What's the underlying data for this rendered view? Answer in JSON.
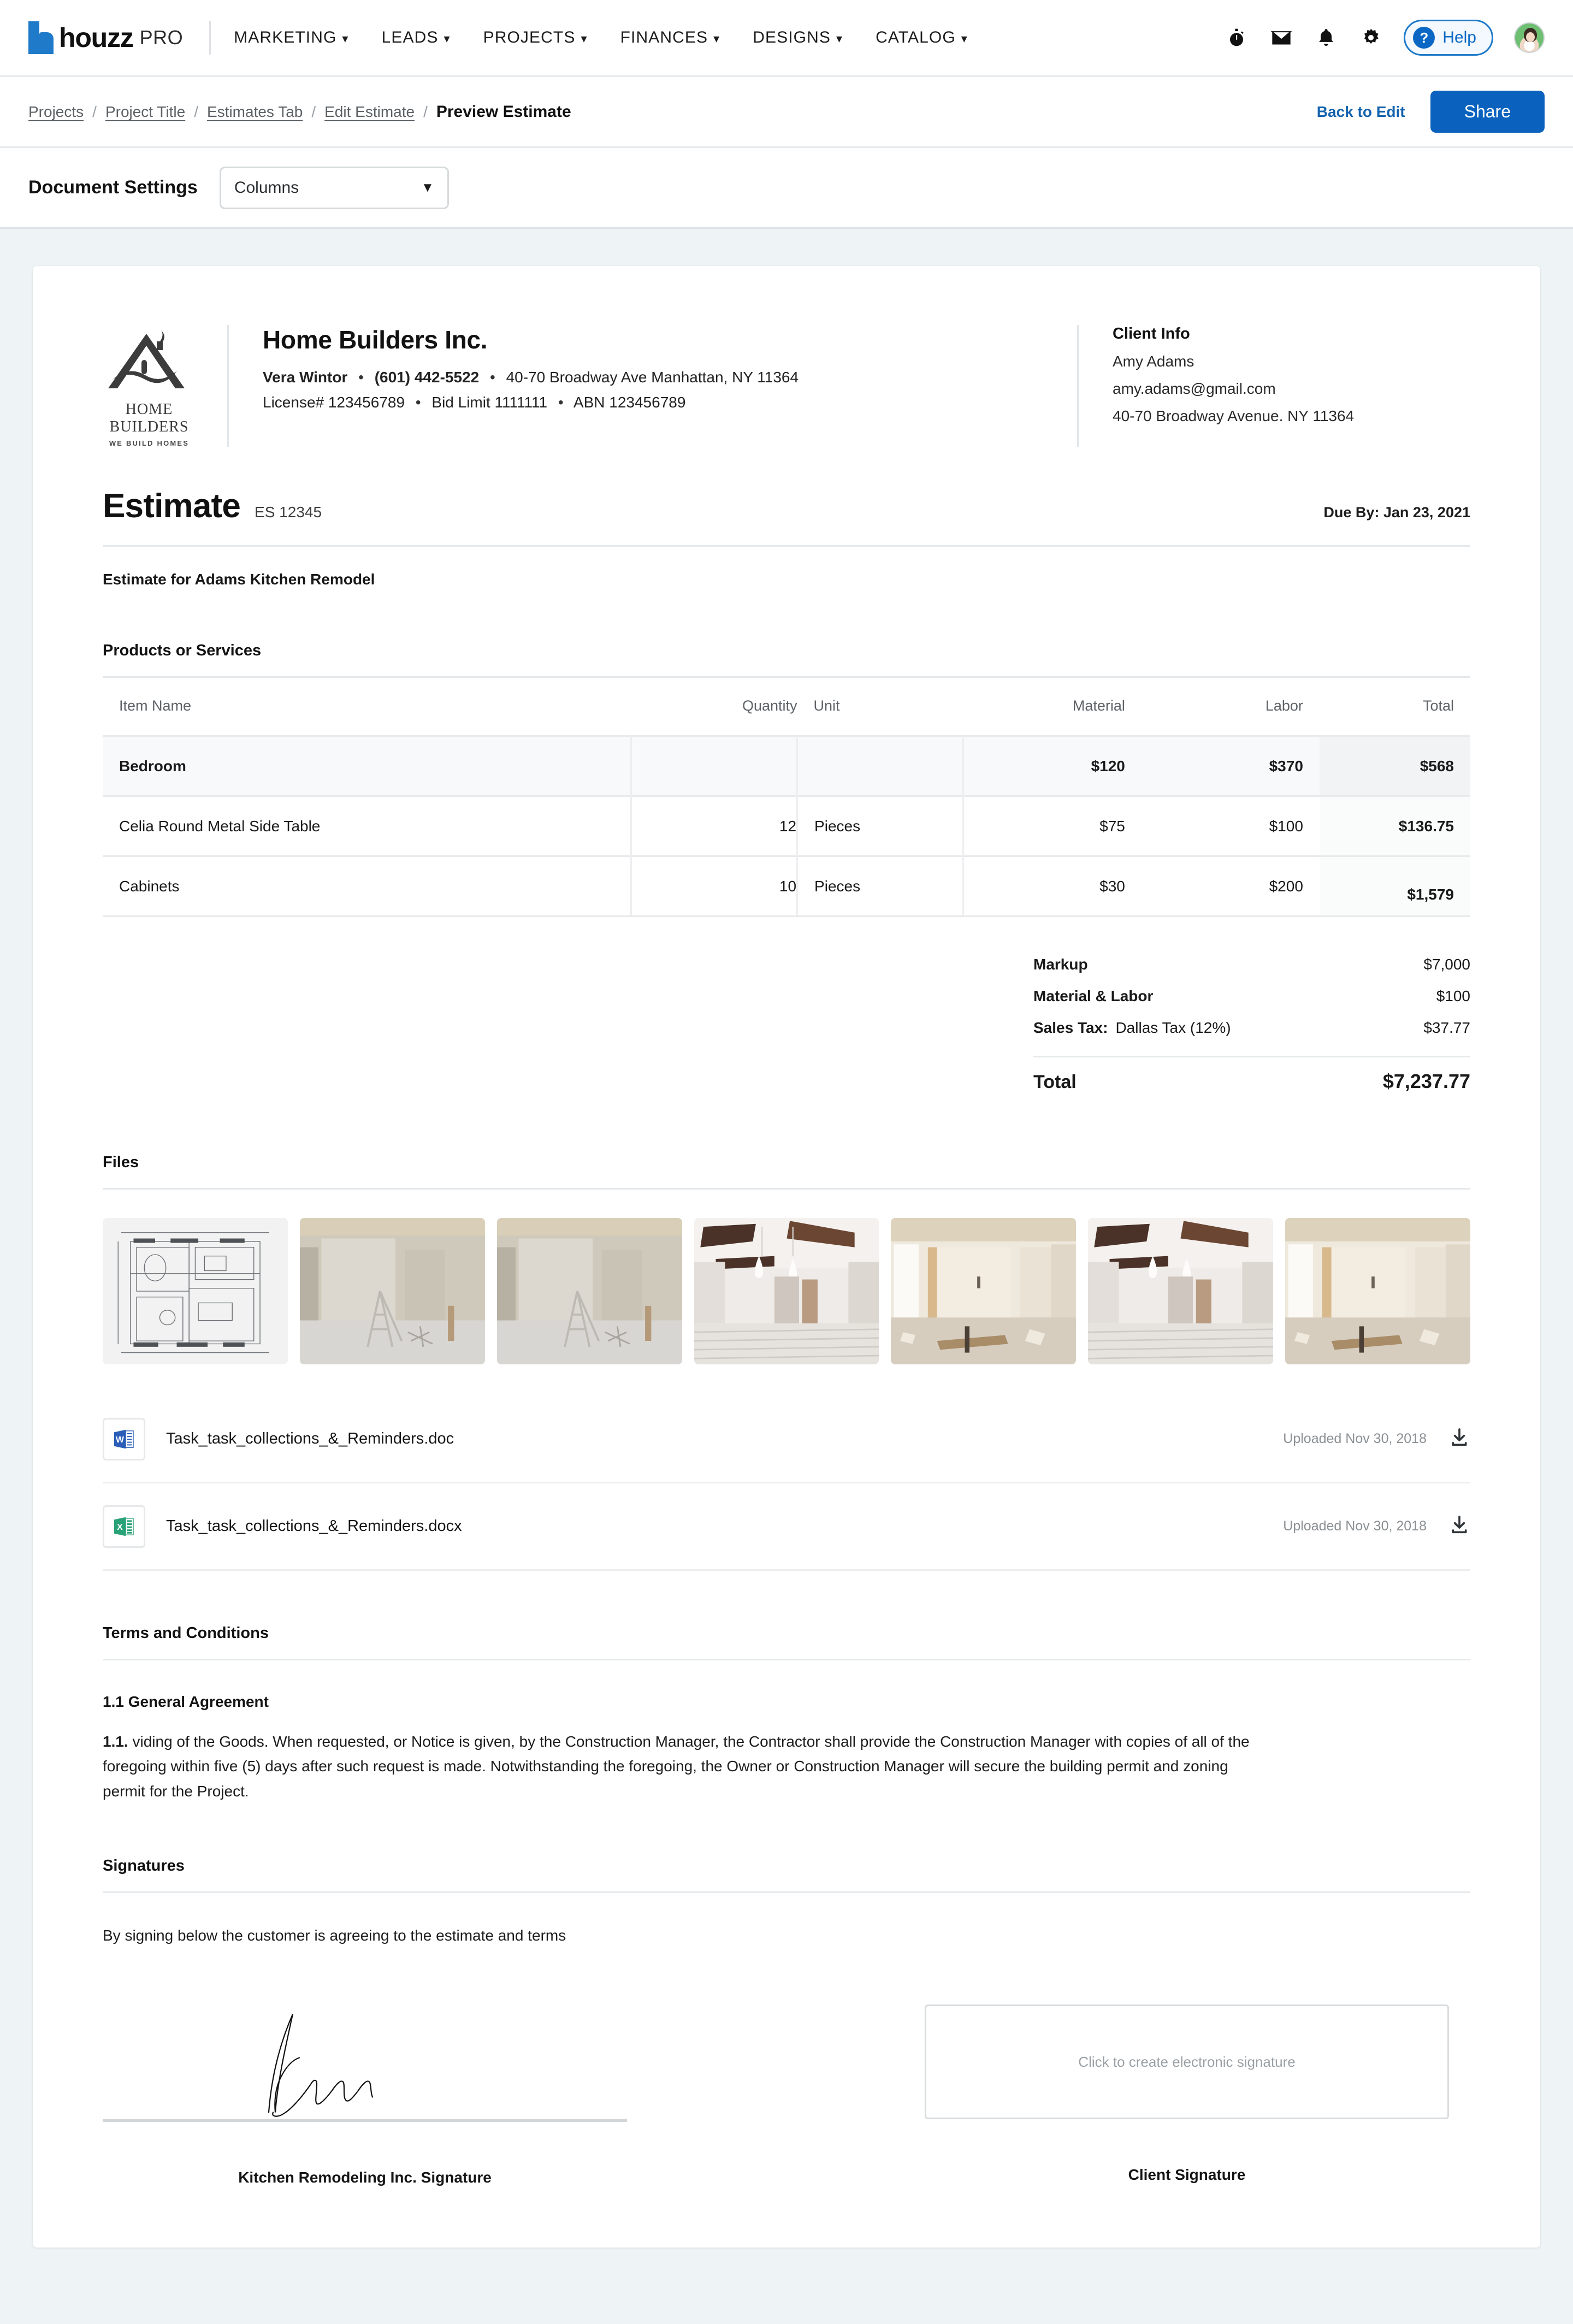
{
  "topnav": {
    "brand": "houzz",
    "brand_suffix": "PRO",
    "menu": [
      {
        "label": "MARKETING"
      },
      {
        "label": "LEADS"
      },
      {
        "label": "PROJECTS"
      },
      {
        "label": "FINANCES"
      },
      {
        "label": "DESIGNS"
      },
      {
        "label": "CATALOG"
      }
    ],
    "help_label": "Help",
    "accent_color": "#0a68c4"
  },
  "breadcrumb": {
    "items": [
      {
        "label": "Projects",
        "current": false
      },
      {
        "label": "Project Title",
        "current": false
      },
      {
        "label": "Estimates Tab",
        "current": false
      },
      {
        "label": "Edit Estimate",
        "current": false
      },
      {
        "label": "Preview Estimate",
        "current": true
      }
    ],
    "separator": "/",
    "back_to_edit": "Back to Edit",
    "share": "Share",
    "share_color": "#0a62be"
  },
  "document_settings": {
    "title": "Document Settings",
    "select_value": "Columns"
  },
  "company": {
    "logo_title": "HOME BUILDERS",
    "logo_tagline": "WE BUILD HOMES",
    "name": "Home Builders Inc.",
    "contact_name": "Vera Wintor",
    "phone": "(601) 442-5522",
    "address": "40-70 Broadway Ave Manhattan, NY 11364",
    "license": "License# 123456789",
    "bid_limit": "Bid Limit 1111111",
    "abn": "ABN 123456789",
    "dot": "•"
  },
  "client": {
    "title": "Client Info",
    "name": "Amy Adams",
    "email": "amy.adams@gmail.com",
    "address": "40-70 Broadway Avenue. NY 11364"
  },
  "estimate": {
    "title": "Estimate",
    "number": "ES 12345",
    "due": "Due By: Jan 23, 2021",
    "description": "Estimate for Adams Kitchen Remodel"
  },
  "products": {
    "section_label": "Products or Services",
    "columns": [
      "Item Name",
      "Quantity",
      "Unit",
      "Material",
      "Labor",
      "Total"
    ],
    "rows": [
      {
        "item": "Bedroom",
        "quantity": "",
        "unit": "",
        "material": "$120",
        "labor": "$370",
        "total": "$568",
        "group": true
      },
      {
        "item": "Celia Round Metal Side Table",
        "quantity": "12",
        "unit": "Pieces",
        "material": "$75",
        "labor": "$100",
        "total": "$136.75",
        "group": false
      },
      {
        "item": "Cabinets",
        "quantity": "10",
        "unit": "Pieces",
        "material": "$30",
        "labor": "$200",
        "total": "$1,579",
        "group": false
      }
    ]
  },
  "totals": {
    "markup_label": "Markup",
    "markup_value": "$7,000",
    "matlabor_label": "Material & Labor",
    "matlabor_value": "$100",
    "tax_label": "Sales Tax:",
    "tax_name": "Dallas Tax (12%)",
    "tax_value": "$37.77",
    "total_label": "Total",
    "total_value": "$7,237.77"
  },
  "files": {
    "section_label": "Files",
    "thumbnails": [
      {
        "name": "blueprint-thumbnail"
      },
      {
        "name": "interior-ladder-thumbnail-1"
      },
      {
        "name": "interior-ladder-thumbnail-2"
      },
      {
        "name": "hallway-beams-thumbnail-1"
      },
      {
        "name": "interior-doorway-thumbnail-1"
      },
      {
        "name": "hallway-beams-thumbnail-2"
      },
      {
        "name": "interior-doorway-thumbnail-2"
      }
    ],
    "attachments": [
      {
        "icon": "word-file-icon",
        "name": "Task_task_collections_&_Reminders.doc",
        "meta": "Uploaded Nov 30, 2018"
      },
      {
        "icon": "excel-file-icon",
        "name": "Task_task_collections_&_Reminders.docx",
        "meta": "Uploaded Nov 30, 2018"
      }
    ]
  },
  "terms": {
    "section_label": "Terms and Conditions",
    "heading": "1.1 General Agreement",
    "clause_number": "1.1.",
    "body": " viding of the Goods. When requested, or Notice is given, by the Construction Manager, the Contractor shall provide the Construction Manager with copies of all of the foregoing within five (5) days after such request is made. Notwithstanding the foregoing, the Owner or Construction Manager will secure the building permit and zoning permit for the Project."
  },
  "signatures": {
    "section_label": "Signatures",
    "note": "By signing below the customer is agreeing to the estimate and terms",
    "contractor_caption": "Kitchen Remodeling Inc. Signature",
    "client_caption": "Client Signature",
    "client_placeholder": "Click to create electronic signature"
  }
}
